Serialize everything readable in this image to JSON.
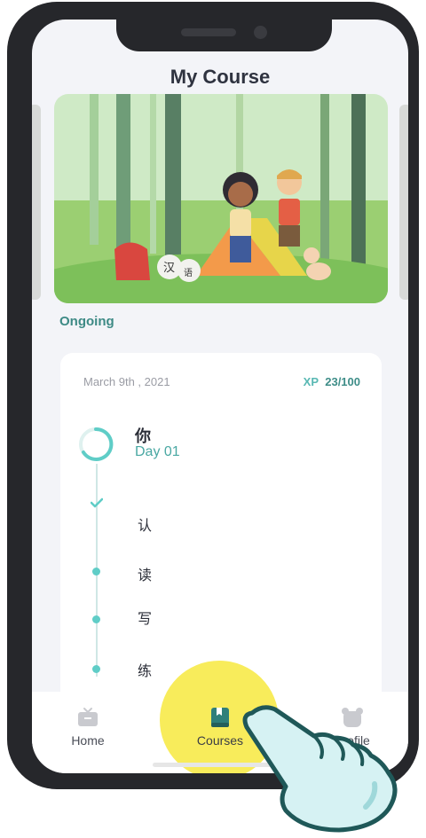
{
  "header": {
    "title": "My Course"
  },
  "hero": {
    "book_text_1": "汉",
    "book_text_2": "语"
  },
  "section": {
    "ongoing_label": "Ongoing"
  },
  "course_card": {
    "date": "March 9th , 2021",
    "xp_label": "XP",
    "xp_value": "23/100",
    "lesson": {
      "character": "你",
      "day": "Day 01"
    },
    "steps": [
      {
        "label": "认",
        "status": "completed"
      },
      {
        "label": "读",
        "status": "pending"
      },
      {
        "label": "写",
        "status": "pending"
      },
      {
        "label": "练",
        "status": "pending"
      }
    ]
  },
  "nav": {
    "items": [
      {
        "label": "Home",
        "icon": "tv-icon"
      },
      {
        "label": "Courses",
        "icon": "book-icon",
        "active": true
      },
      {
        "label": "Profile",
        "icon": "bear-icon"
      }
    ]
  },
  "colors": {
    "accent": "#4aa8a3",
    "highlight": "#f8ec5b",
    "title": "#2f3340"
  }
}
